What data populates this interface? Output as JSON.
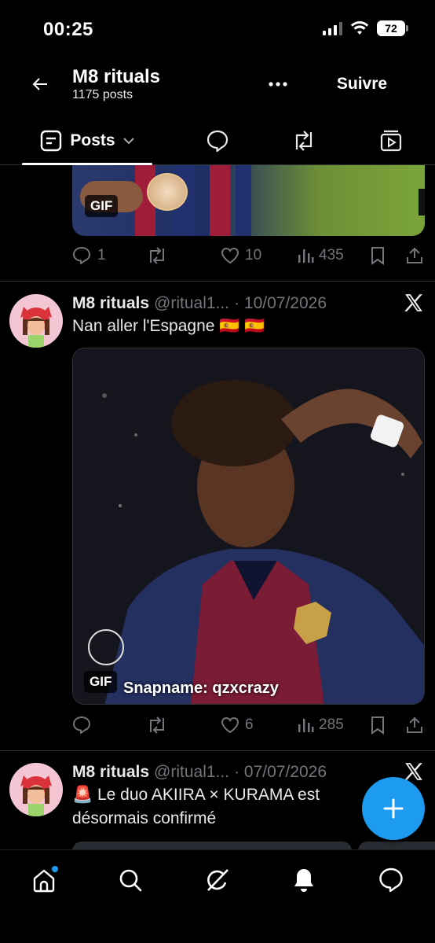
{
  "status_bar": {
    "time": "00:25",
    "battery": "72"
  },
  "header": {
    "title": "M8 rituals",
    "post_count": "1175 posts",
    "follow_label": "Suivre"
  },
  "tabs": {
    "posts_label": "Posts"
  },
  "post_top": {
    "gif_label": "GIF",
    "replies": "1",
    "likes": "10",
    "views": "435"
  },
  "tweet1": {
    "name": "M8 rituals",
    "handle": "@ritual1...",
    "date": "· 10/07/2026",
    "text": "Nan aller l'Espagne 🇪🇸 🇪🇸",
    "gif_label": "GIF",
    "caption": "Snapname: qzxcrazy",
    "likes": "6",
    "views": "285"
  },
  "tweet2": {
    "name": "M8 rituals",
    "handle": "@ritual1...",
    "date": "· 07/07/2026",
    "text": "🚨 Le duo AKIIRA × KURAMA est désormais confirmé"
  },
  "colors": {
    "accent": "#1d9bf0",
    "muted": "#71767b",
    "divider": "#2f3336"
  },
  "icons": [
    "back-arrow-icon",
    "more-dots-icon",
    "posts-icon",
    "chevron-down-icon",
    "replies-icon",
    "reposts-icon",
    "media-icon",
    "reply-icon",
    "repost-icon",
    "like-icon",
    "views-icon",
    "bookmark-icon",
    "share-icon",
    "x-logo-icon",
    "compose-plus-icon",
    "home-icon",
    "search-icon",
    "grok-icon",
    "bell-icon",
    "messages-icon"
  ]
}
